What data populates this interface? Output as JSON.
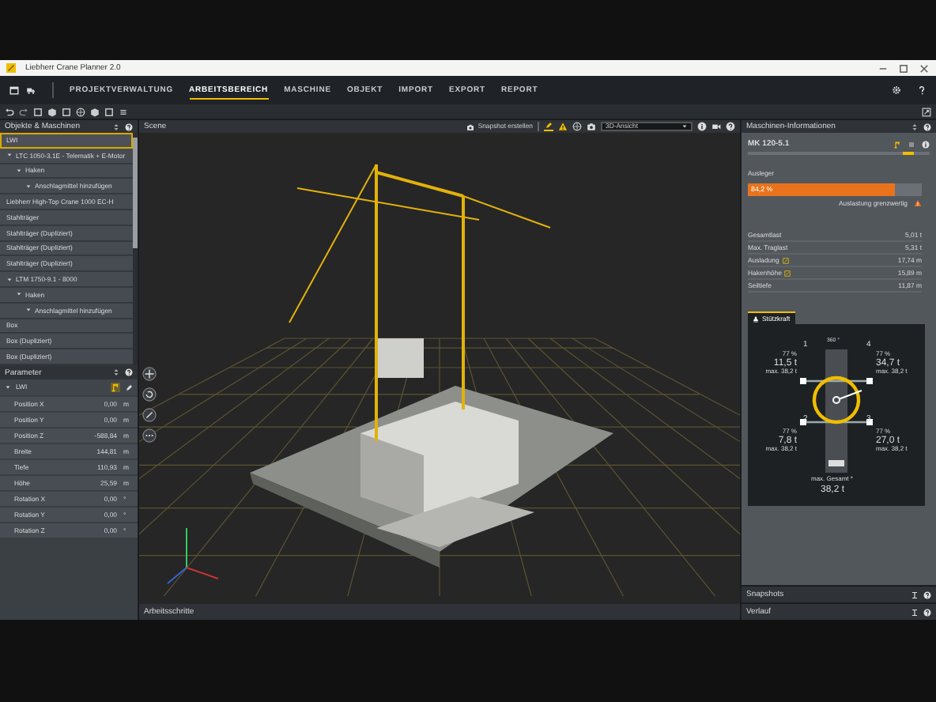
{
  "window": {
    "title": "Liebherr Crane Planner 2.0"
  },
  "menu": [
    {
      "label": "PROJEKTVERWALTUNG",
      "selected": false
    },
    {
      "label": "ARBEITSBEREICH",
      "selected": true
    },
    {
      "label": "MASCHINE",
      "selected": false
    },
    {
      "label": "OBJEKT",
      "selected": false
    },
    {
      "label": "IMPORT",
      "selected": false
    },
    {
      "label": "EXPORT",
      "selected": false
    },
    {
      "label": "REPORT",
      "selected": false
    }
  ],
  "objects_panel": {
    "title": "Objekte & Maschinen",
    "tree": [
      {
        "label": "LWI",
        "selected": true
      },
      {
        "label": "LTC 1050-3.1E - Telematik + E-Motor",
        "selected": false,
        "expanded": true,
        "children": [
          {
            "label": "Haken",
            "selected": false,
            "expanded": true,
            "children": [
              {
                "label": "Anschlagmittel hinzufügen",
                "selected": false,
                "expanded": true
              }
            ]
          }
        ]
      },
      {
        "label": "Liebherr High-Top Crane 1000 EC-H",
        "selected": false
      },
      {
        "label": "Stahlträger",
        "selected": false
      },
      {
        "label": "Stahlträger (Dupliziert)",
        "selected": false
      },
      {
        "label": "Stahlträger (Dupliziert)",
        "selected": false
      },
      {
        "label": "Stahlträger (Dupliziert)",
        "selected": false
      },
      {
        "label": "LTM 1750-9.1 - 8000",
        "selected": false,
        "expanded": true,
        "children": [
          {
            "label": "Haken",
            "selected": false,
            "expanded": true,
            "children": [
              {
                "label": "Anschlagmittel hinzufügen",
                "selected": false,
                "expanded": true
              }
            ]
          }
        ]
      },
      {
        "label": "Box",
        "selected": false
      },
      {
        "label": "Box (Dupliziert)",
        "selected": false
      },
      {
        "label": "Box (Dupliziert)",
        "selected": false
      }
    ]
  },
  "parameters": {
    "title": "Parameter",
    "group": {
      "label": "LWI",
      "expanded": true
    },
    "rows": [
      {
        "name": "Position X",
        "value": "0,00",
        "unit": "m"
      },
      {
        "name": "Position Y",
        "value": "0,00",
        "unit": "m"
      },
      {
        "name": "Position Z",
        "value": "-588,84",
        "unit": "m"
      },
      {
        "name": "Breite",
        "value": "144,81",
        "unit": "m"
      },
      {
        "name": "Tiefe",
        "value": "110,93",
        "unit": "m"
      },
      {
        "name": "Höhe",
        "value": "25,59",
        "unit": "m"
      },
      {
        "name": "Rotation X",
        "value": "0,00",
        "unit": "°"
      },
      {
        "name": "Rotation Y",
        "value": "0,00",
        "unit": "°"
      },
      {
        "name": "Rotation Z",
        "value": "0,00",
        "unit": "°"
      }
    ]
  },
  "scene": {
    "title": "Scene",
    "snapshot_button": "Snapshot erstellen",
    "view_select": "3D-Ansicht",
    "footer": "Arbeitsschritte"
  },
  "machine_info": {
    "title": "Maschinen-Informationen",
    "machine": "MK 120-5.1",
    "boom": {
      "label": "Ausleger",
      "level": 0.842,
      "reading": "84,2 %",
      "warning": "Auslastung grenzwertig"
    },
    "stats": [
      {
        "name": "Gesamtlast",
        "value": "5,01 t",
        "linked": false
      },
      {
        "name": "Max. Traglast",
        "value": "5,31 t",
        "linked": false
      },
      {
        "name": "Ausladung",
        "value": "17,74 m",
        "linked": true
      },
      {
        "name": "Hakenhöhe",
        "value": "15,89 m",
        "linked": true
      },
      {
        "name": "Seiltiefe",
        "value": "11,87 m",
        "linked": false
      }
    ],
    "tabs": [
      {
        "label": "Stützkraft",
        "selected": true
      }
    ],
    "rotation": "360 °",
    "outriggers": [
      {
        "number": "1",
        "percent": "77 %",
        "load": "11,5 t",
        "max": "max. 38,2 t"
      },
      {
        "number": "4",
        "percent": "77 %",
        "load": "34,7 t",
        "max": "max. 38,2 t"
      },
      {
        "number": "2",
        "percent": "77 %",
        "load": "7,8 t",
        "max": "max. 38,2 t"
      },
      {
        "number": "3",
        "percent": "77 %",
        "load": "27,0 t",
        "max": "max. 38,2 t"
      }
    ],
    "total_label": "max. Gesamt *",
    "total": "38,2 t"
  },
  "footer_panels": [
    "Snapshots",
    "Verlauf"
  ]
}
